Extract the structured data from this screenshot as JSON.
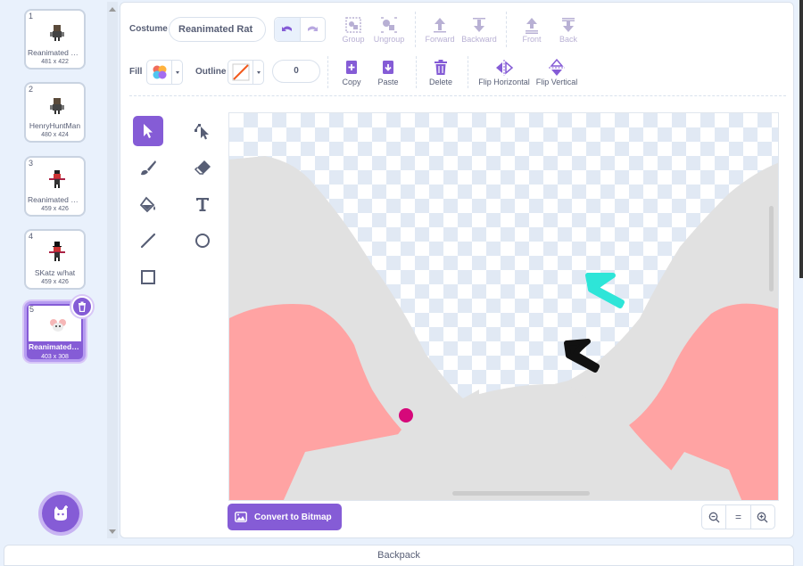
{
  "costumes": [
    {
      "number": "1",
      "name": "Reanimated Hunt Man",
      "size": "481 x 422",
      "selected": false
    },
    {
      "number": "2",
      "name": "HenryHuntMan",
      "size": "480 x 424",
      "selected": false
    },
    {
      "number": "3",
      "name": "Reanimated SKatz",
      "size": "459 x 426",
      "selected": false
    },
    {
      "number": "4",
      "name": "SKatz w/hat",
      "size": "459 x 426",
      "selected": false
    },
    {
      "number": "5",
      "name": "Reanimated Mouse",
      "size": "403 x 308",
      "selected": true
    }
  ],
  "editor": {
    "costume_label": "Costume",
    "costume_name": "Reanimated Rat",
    "fill_label": "Fill",
    "outline_label": "Outline",
    "outline_width": "0",
    "top_tools": [
      {
        "label": "Group",
        "icon": "group-icon"
      },
      {
        "label": "Ungroup",
        "icon": "ungroup-icon"
      },
      {
        "label": "Forward",
        "icon": "forward-icon"
      },
      {
        "label": "Backward",
        "icon": "backward-icon"
      },
      {
        "label": "Front",
        "icon": "front-icon"
      },
      {
        "label": "Back",
        "icon": "back-icon"
      }
    ],
    "edit_tools": [
      {
        "label": "Copy",
        "icon": "copy-icon"
      },
      {
        "label": "Paste",
        "icon": "paste-icon"
      },
      {
        "label": "Delete",
        "icon": "delete-icon"
      },
      {
        "label": "Flip Horizontal",
        "icon": "flip-horizontal-icon"
      },
      {
        "label": "Flip Vertical",
        "icon": "flip-vertical-icon"
      }
    ],
    "convert_label": "Convert to Bitmap",
    "zoom_reset_label": "="
  },
  "backpack_label": "Backpack",
  "colors": {
    "accent": "#855cd6",
    "pink": "#ffa3a3",
    "ear_gray": "#e0e0e0",
    "cyan": "#2ee5d8",
    "magenta": "#d6087a"
  }
}
